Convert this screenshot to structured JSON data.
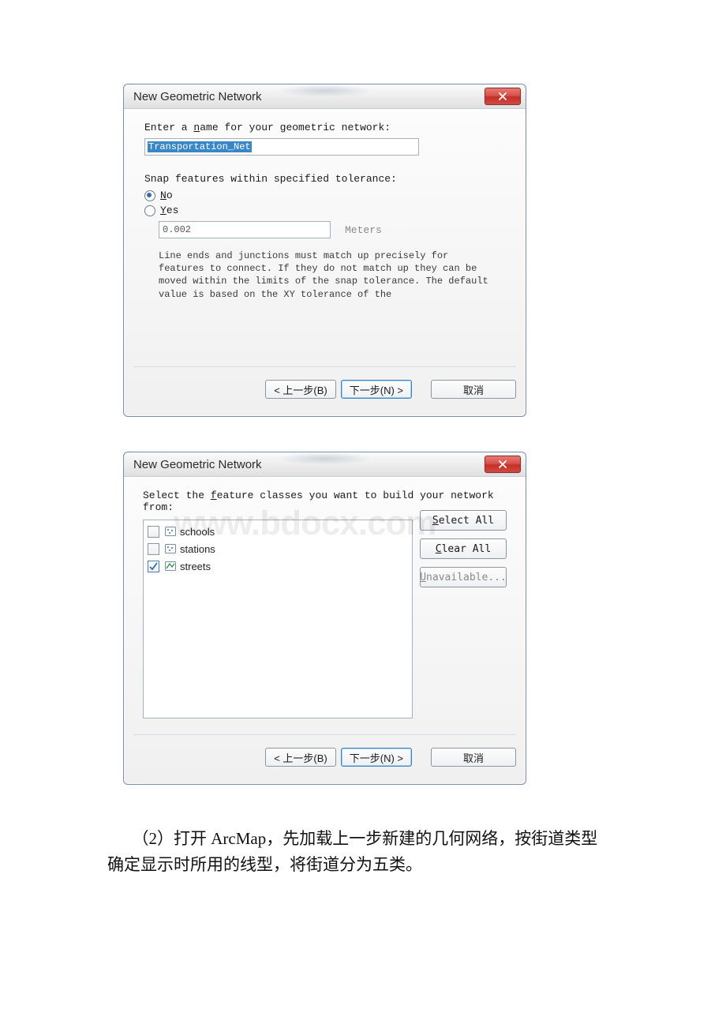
{
  "dialog1": {
    "title": "New Geometric Network",
    "name_label_pre": "Enter a ",
    "name_label_u": "n",
    "name_label_post": "ame for your geometric network:",
    "name_value": "Transportation_Net",
    "snap_label": "Snap features within specified tolerance:",
    "radio_no_u": "N",
    "radio_no_post": "o",
    "radio_yes_u": "Y",
    "radio_yes_post": "es",
    "tolerance_value": "0.002",
    "tolerance_unit": "Meters",
    "note": "Line ends and junctions must match up precisely for features to connect. If they do not match up they can be moved within the limits of the snap tolerance. The default value is based on the XY tolerance of the",
    "back": "< 上一步(B)",
    "next": "下一步(N) >",
    "cancel": "取消"
  },
  "dialog2": {
    "title": "New Geometric Network",
    "prompt_pre": "Select the ",
    "prompt_u": "f",
    "prompt_post": "eature classes you want to build your network from:",
    "fc": [
      {
        "name": "schools",
        "checked": false,
        "type": "point"
      },
      {
        "name": "stations",
        "checked": false,
        "type": "point"
      },
      {
        "name": "streets",
        "checked": true,
        "type": "line"
      }
    ],
    "select_all_u": "S",
    "select_all_post": "elect All",
    "clear_all_u": "C",
    "clear_all_post": "lear All",
    "unavailable_u": "U",
    "unavailable_post": "navailable...",
    "back": "< 上一步(B)",
    "next": "下一步(N) >",
    "cancel": "取消"
  },
  "watermark": "www.bdocx.com",
  "paragraph": "　　（2）打开 ArcMap，先加载上一步新建的几何网络，按街道类型确定显示时所用的线型，将街道分为五类。"
}
